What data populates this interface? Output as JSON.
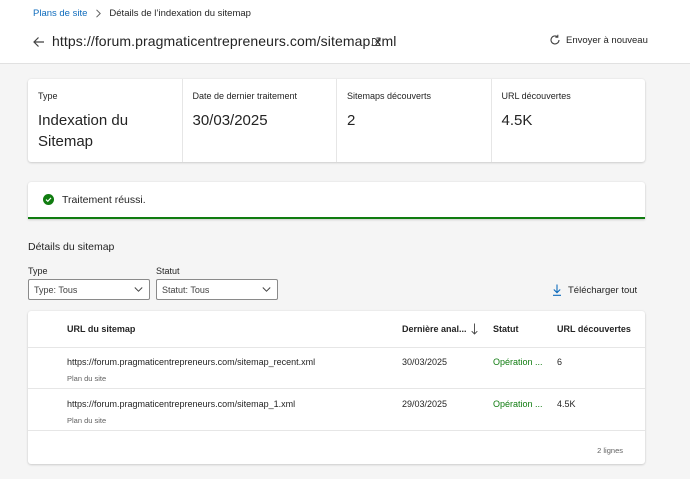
{
  "breadcrumb": {
    "parent": "Plans de site",
    "current": "Détails de l’indexation du sitemap"
  },
  "header": {
    "url": "https://forum.pragmaticentrepreneurs.com/sitemap.xml",
    "resubmit_label": "Envoyer à nouveau"
  },
  "summary": [
    {
      "label": "Type",
      "value": "Indexation du Sitemap"
    },
    {
      "label": "Date de dernier traitement",
      "value": "30/03/2025"
    },
    {
      "label": "Sitemaps découverts",
      "value": "2"
    },
    {
      "label": "URL découvertes",
      "value": "4.5K"
    }
  ],
  "status": {
    "text": "Traitement réussi.",
    "color": "#107c10"
  },
  "details": {
    "title": "Détails du sitemap",
    "filters": {
      "type_label": "Type",
      "type_value": "Type: Tous",
      "status_label": "Statut",
      "status_value": "Statut: Tous"
    },
    "download_label": "Télécharger tout"
  },
  "table": {
    "columns": [
      "URL du sitemap",
      "Dernière anal...",
      "Statut",
      "URL découvertes"
    ],
    "rows": [
      {
        "url": "https://forum.pragmaticentrepreneurs.com/sitemap_recent.xml",
        "kind": "Plan du site",
        "date": "30/03/2025",
        "status": "Opération ...",
        "count": "6"
      },
      {
        "url": "https://forum.pragmaticentrepreneurs.com/sitemap_1.xml",
        "kind": "Plan du site",
        "date": "29/03/2025",
        "status": "Opération ...",
        "count": "4.5K"
      }
    ],
    "footer": "2 lignes"
  },
  "colors": {
    "accent": "#0f6cbd",
    "success": "#107c10"
  }
}
